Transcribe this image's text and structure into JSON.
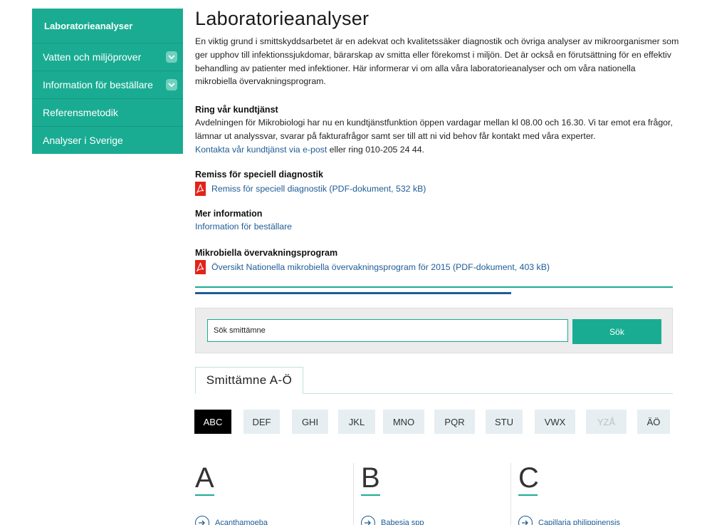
{
  "sidebar": {
    "items": [
      {
        "label": "Laboratorieanalyser",
        "active": true,
        "expandable": false
      },
      {
        "label": "Vatten och miljöprover",
        "active": false,
        "expandable": true
      },
      {
        "label": "Information för beställare",
        "active": false,
        "expandable": true
      },
      {
        "label": "Referensmetodik",
        "active": false,
        "expandable": false
      },
      {
        "label": "Analyser i Sverige",
        "active": false,
        "expandable": false
      }
    ]
  },
  "main": {
    "title": "Laboratorieanalyser",
    "intro": "En viktig grund i smittskyddsarbetet är en adekvat och kvalitetssäker diagnostik och övriga analyser av mikroorganismer som ger upphov till infektionssjukdomar, bärarskap av smitta eller förekomst i miljön. Det är också en förutsättning för en effektiv behandling av patienter med infektioner. Här informerar vi om alla våra laboratorieanalyser och om våra nationella mikrobiella övervakningsprogram.",
    "customer_service": {
      "heading": "Ring vår kundtjänst",
      "body": "Avdelningen för Mikrobiologi har nu en kundtjänstfunktion öppen vardagar mellan kl 08.00 och 16.30. Vi tar emot era frågor, lämnar ut analyssvar, svarar på fakturafrågor samt ser till att ni vid behov får kontakt med våra experter.",
      "link": "Kontakta vår kundtjänst via e-post",
      "suffix": " eller ring 010-205 24 44."
    },
    "remiss": {
      "heading": "Remiss för speciell diagnostik",
      "link": "Remiss för speciell diagnostik (PDF-dokument, 532 kB)"
    },
    "more_info": {
      "heading": "Mer information",
      "link": "Information för beställare"
    },
    "monitoring": {
      "heading": "Mikrobiella övervakningsprogram",
      "link": "Översikt Nationella mikrobiella övervakningsprogram för 2015 (PDF-dokument, 403 kB)"
    }
  },
  "search": {
    "value": "Sök smittämne",
    "button": "Sök"
  },
  "tabs": {
    "active": "Smittämne A-Ö"
  },
  "letters": [
    {
      "label": "ABC",
      "active": true
    },
    {
      "label": "DEF",
      "active": false
    },
    {
      "label": "GHI",
      "active": false
    },
    {
      "label": "JKL",
      "active": false
    },
    {
      "label": "MNO",
      "active": false
    },
    {
      "label": "PQR",
      "active": false
    },
    {
      "label": "STU",
      "active": false
    },
    {
      "label": "VWX",
      "active": false
    },
    {
      "label": "YZÅ",
      "active": false
    },
    {
      "label": "ÄÖ",
      "active": false
    }
  ],
  "columns": [
    {
      "letter": "A",
      "first_entry": "Acanthamoeba"
    },
    {
      "letter": "B",
      "first_entry": "Babesia spp"
    },
    {
      "letter": "C",
      "first_entry": "Capillaria philippinensis"
    }
  ],
  "colors": {
    "accent": "#1aac93",
    "link": "#1e5c95",
    "pdf_red": "#e2231a"
  }
}
